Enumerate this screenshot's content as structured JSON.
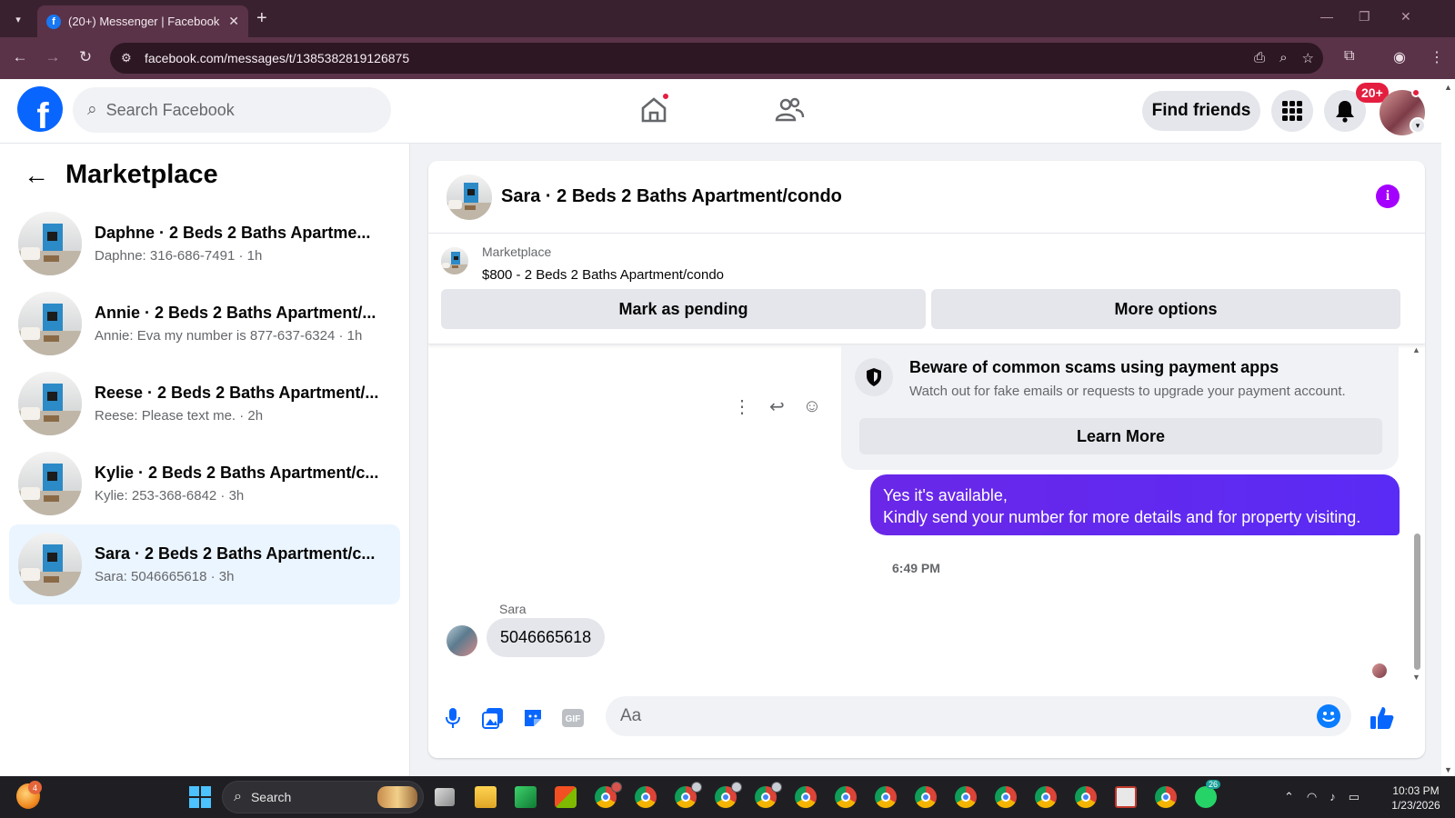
{
  "browser": {
    "tab_title": "(20+) Messenger | Facebook",
    "url": "facebook.com/messages/t/1385382819126875"
  },
  "header": {
    "search_placeholder": "Search Facebook",
    "find_friends_label": "Find friends",
    "notification_badge": "20+"
  },
  "sidebar": {
    "title": "Marketplace",
    "conversations": [
      {
        "name": "Daphne · 2 Beds 2 Baths Apartme...",
        "preview": "Daphne: 316-686-7491 · 1h",
        "active": false
      },
      {
        "name": "Annie · 2 Beds 2 Baths Apartment/...",
        "preview": "Annie: Eva my number is 877-637-6324 · 1h",
        "active": false
      },
      {
        "name": "Reese · 2 Beds 2 Baths Apartment/...",
        "preview": "Reese: Please text me. · 2h",
        "active": false
      },
      {
        "name": "Kylie · 2 Beds 2 Baths Apartment/c...",
        "preview": "Kylie: 253-368-6842 · 3h",
        "active": false
      },
      {
        "name": "Sara · 2 Beds 2 Baths Apartment/c...",
        "preview": "Sara: 5046665618 · 3h",
        "active": true
      }
    ]
  },
  "chat": {
    "title": "Sara · 2 Beds 2 Baths Apartment/condo",
    "listing": {
      "category": "Marketplace",
      "price_title": "$800 - 2 Beds 2 Baths Apartment/condo",
      "mark_pending_label": "Mark as pending",
      "more_options_label": "More options"
    },
    "scam_notice": {
      "title": "Beware of common scams using payment apps",
      "body": "Watch out for fake emails or requests to upgrade your payment account.",
      "button_label": "Learn More"
    },
    "outgoing_message": {
      "line1": "Yes it's available,",
      "line2": "Kindly send your number for more details and for property visiting."
    },
    "timestamp": "6:49 PM",
    "incoming": {
      "sender": "Sara",
      "text": "5046665618"
    },
    "composer_placeholder": "Aa"
  },
  "taskbar": {
    "search_label": "Search",
    "left_badge": "4",
    "whatsapp_badge": "26",
    "time": "10:03 PM",
    "date": "1/23/2026"
  },
  "colors": {
    "facebook_blue": "#0866ff",
    "messenger_purple": "#5d26f2",
    "info_purple": "#a300ff",
    "badge_red": "#e41e3f"
  }
}
